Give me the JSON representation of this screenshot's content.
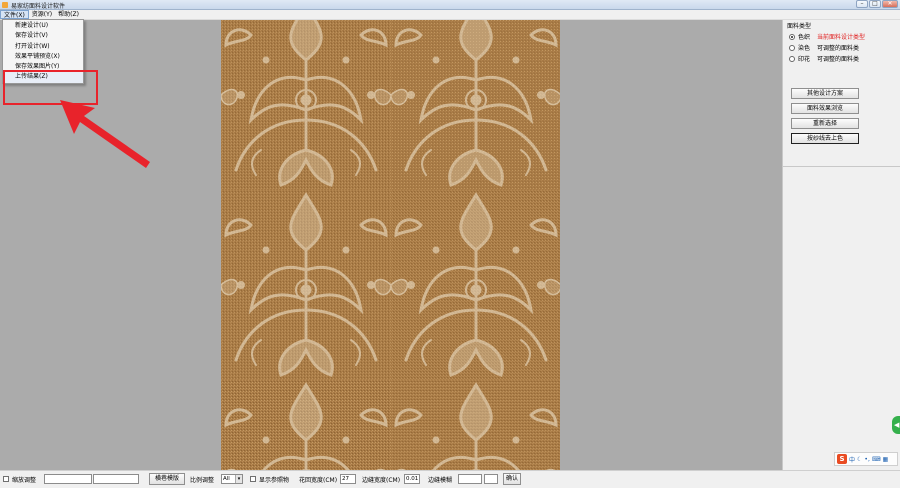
{
  "window": {
    "title": "易家纺面料设计软件"
  },
  "menubar": {
    "items": [
      {
        "label": "文件(X)",
        "active": true
      },
      {
        "label": "资源(Y)",
        "active": false
      },
      {
        "label": "帮助(Z)",
        "active": false
      }
    ]
  },
  "file_menu": {
    "items": [
      "新建设计(U)",
      "保存设计(V)",
      "打开设计(W)",
      "效果平铺预览(X)",
      "保存效果图片(Y)",
      "上传结果(Z)"
    ]
  },
  "right_panel": {
    "group_label": "面料类型",
    "options": [
      {
        "label": "色织",
        "desc": "当前面料设计类型",
        "checked": true,
        "desc_color": "#e02020"
      },
      {
        "label": "染色",
        "desc": "可调整的面料类",
        "checked": false
      },
      {
        "label": "印花",
        "desc": "可调整的面料类",
        "checked": false
      }
    ],
    "buttons": [
      "其他设计方案",
      "面料效果浏览",
      "重新选择",
      "按纱线去上色"
    ]
  },
  "statusbar": {
    "zoom_label": "缩放调整",
    "grid_button": "横巷模版",
    "ratio_label": "比例调整",
    "ratio_value": "All",
    "show_ref_label": "显示参照物",
    "pattern_width_label": "花回宽度(CM)",
    "pattern_width_value": "27",
    "border_width_label": "边缝宽度(CM)",
    "border_width_value": "0.01",
    "border_blur_label": "边缝模糊",
    "confirm_button": "确认"
  },
  "tray": {
    "icons": [
      "sogou-icon",
      "moon-icon",
      "punctuation-icon",
      "keyboard-icon"
    ],
    "text": "中"
  },
  "colors": {
    "fabric_base": "#a87a45",
    "fabric_pattern": "#e4d2b5",
    "highlight": "#e8232b"
  }
}
